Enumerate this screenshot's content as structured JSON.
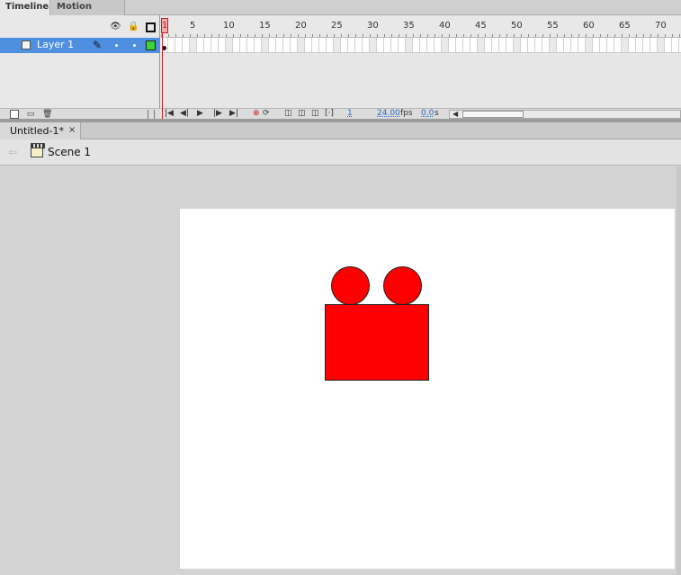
{
  "panel_tabs": {
    "timeline": "Timeline",
    "motion_editor": "Motion Editor"
  },
  "timeline": {
    "header_icons": [
      "eye-icon",
      "lock-icon",
      "outline-icon"
    ],
    "layer": {
      "name": "Layer 1",
      "outline_color": "#36d637",
      "selected_color": "#4f8fe0"
    },
    "ruler_labels": [
      "1",
      "5",
      "10",
      "15",
      "20",
      "25",
      "30",
      "35",
      "40",
      "45",
      "50",
      "55",
      "60",
      "65",
      "70"
    ],
    "current_frame_label": "1",
    "controls": {
      "current_frame": "1",
      "fps": "24.00",
      "fps_unit": "fps",
      "elapsed": "0.0",
      "elapsed_unit": "s"
    }
  },
  "document": {
    "tab_label": "Untitled-1*",
    "close_label": "×"
  },
  "edit_bar": {
    "scene_label": "Scene 1"
  },
  "stage": {
    "background": "#ffffff",
    "shape_color": "#ff0000"
  }
}
